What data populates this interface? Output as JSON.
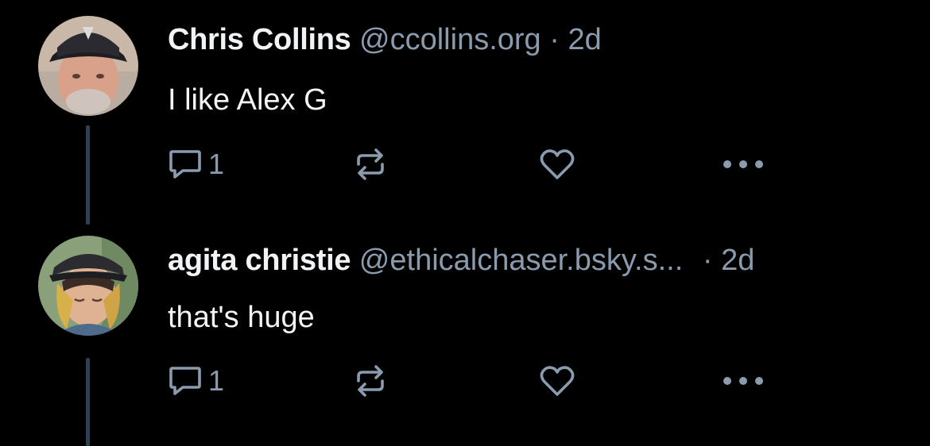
{
  "colors": {
    "background": "#000000",
    "text_primary": "#f1f3f5",
    "text_secondary": "#8a9bae",
    "thread_line": "#2e4052"
  },
  "posts": [
    {
      "display_name": "Chris Collins",
      "handle": "@ccollins.org",
      "separator": "·",
      "time": "2d",
      "text": "I like Alex G",
      "reply_count": "1",
      "icons": [
        "reply-icon",
        "repost-icon",
        "like-icon",
        "more-options-icon"
      ]
    },
    {
      "display_name": "agita christie",
      "handle": "@ethicalchaser.bsky.s...",
      "separator": "·",
      "time": "2d",
      "text": "that's huge",
      "reply_count": "1",
      "icons": [
        "reply-icon",
        "repost-icon",
        "like-icon",
        "more-options-icon"
      ]
    }
  ]
}
